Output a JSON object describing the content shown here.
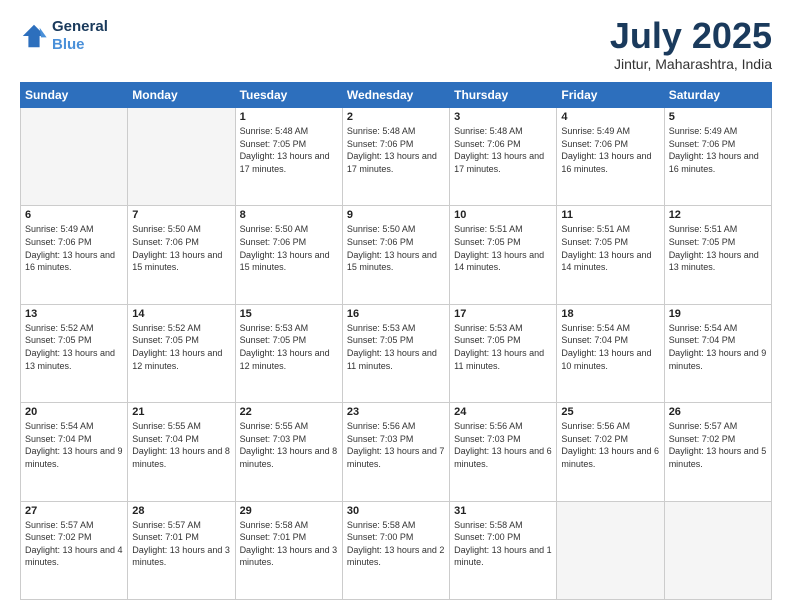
{
  "logo": {
    "line1": "General",
    "line2": "Blue"
  },
  "title": "July 2025",
  "location": "Jintur, Maharashtra, India",
  "days_of_week": [
    "Sunday",
    "Monday",
    "Tuesday",
    "Wednesday",
    "Thursday",
    "Friday",
    "Saturday"
  ],
  "weeks": [
    [
      {
        "day": "",
        "info": ""
      },
      {
        "day": "",
        "info": ""
      },
      {
        "day": "1",
        "info": "Sunrise: 5:48 AM\nSunset: 7:05 PM\nDaylight: 13 hours\nand 17 minutes."
      },
      {
        "day": "2",
        "info": "Sunrise: 5:48 AM\nSunset: 7:06 PM\nDaylight: 13 hours\nand 17 minutes."
      },
      {
        "day": "3",
        "info": "Sunrise: 5:48 AM\nSunset: 7:06 PM\nDaylight: 13 hours\nand 17 minutes."
      },
      {
        "day": "4",
        "info": "Sunrise: 5:49 AM\nSunset: 7:06 PM\nDaylight: 13 hours\nand 16 minutes."
      },
      {
        "day": "5",
        "info": "Sunrise: 5:49 AM\nSunset: 7:06 PM\nDaylight: 13 hours\nand 16 minutes."
      }
    ],
    [
      {
        "day": "6",
        "info": "Sunrise: 5:49 AM\nSunset: 7:06 PM\nDaylight: 13 hours\nand 16 minutes."
      },
      {
        "day": "7",
        "info": "Sunrise: 5:50 AM\nSunset: 7:06 PM\nDaylight: 13 hours\nand 15 minutes."
      },
      {
        "day": "8",
        "info": "Sunrise: 5:50 AM\nSunset: 7:06 PM\nDaylight: 13 hours\nand 15 minutes."
      },
      {
        "day": "9",
        "info": "Sunrise: 5:50 AM\nSunset: 7:06 PM\nDaylight: 13 hours\nand 15 minutes."
      },
      {
        "day": "10",
        "info": "Sunrise: 5:51 AM\nSunset: 7:05 PM\nDaylight: 13 hours\nand 14 minutes."
      },
      {
        "day": "11",
        "info": "Sunrise: 5:51 AM\nSunset: 7:05 PM\nDaylight: 13 hours\nand 14 minutes."
      },
      {
        "day": "12",
        "info": "Sunrise: 5:51 AM\nSunset: 7:05 PM\nDaylight: 13 hours\nand 13 minutes."
      }
    ],
    [
      {
        "day": "13",
        "info": "Sunrise: 5:52 AM\nSunset: 7:05 PM\nDaylight: 13 hours\nand 13 minutes."
      },
      {
        "day": "14",
        "info": "Sunrise: 5:52 AM\nSunset: 7:05 PM\nDaylight: 13 hours\nand 12 minutes."
      },
      {
        "day": "15",
        "info": "Sunrise: 5:53 AM\nSunset: 7:05 PM\nDaylight: 13 hours\nand 12 minutes."
      },
      {
        "day": "16",
        "info": "Sunrise: 5:53 AM\nSunset: 7:05 PM\nDaylight: 13 hours\nand 11 minutes."
      },
      {
        "day": "17",
        "info": "Sunrise: 5:53 AM\nSunset: 7:05 PM\nDaylight: 13 hours\nand 11 minutes."
      },
      {
        "day": "18",
        "info": "Sunrise: 5:54 AM\nSunset: 7:04 PM\nDaylight: 13 hours\nand 10 minutes."
      },
      {
        "day": "19",
        "info": "Sunrise: 5:54 AM\nSunset: 7:04 PM\nDaylight: 13 hours\nand 9 minutes."
      }
    ],
    [
      {
        "day": "20",
        "info": "Sunrise: 5:54 AM\nSunset: 7:04 PM\nDaylight: 13 hours\nand 9 minutes."
      },
      {
        "day": "21",
        "info": "Sunrise: 5:55 AM\nSunset: 7:04 PM\nDaylight: 13 hours\nand 8 minutes."
      },
      {
        "day": "22",
        "info": "Sunrise: 5:55 AM\nSunset: 7:03 PM\nDaylight: 13 hours\nand 8 minutes."
      },
      {
        "day": "23",
        "info": "Sunrise: 5:56 AM\nSunset: 7:03 PM\nDaylight: 13 hours\nand 7 minutes."
      },
      {
        "day": "24",
        "info": "Sunrise: 5:56 AM\nSunset: 7:03 PM\nDaylight: 13 hours\nand 6 minutes."
      },
      {
        "day": "25",
        "info": "Sunrise: 5:56 AM\nSunset: 7:02 PM\nDaylight: 13 hours\nand 6 minutes."
      },
      {
        "day": "26",
        "info": "Sunrise: 5:57 AM\nSunset: 7:02 PM\nDaylight: 13 hours\nand 5 minutes."
      }
    ],
    [
      {
        "day": "27",
        "info": "Sunrise: 5:57 AM\nSunset: 7:02 PM\nDaylight: 13 hours\nand 4 minutes."
      },
      {
        "day": "28",
        "info": "Sunrise: 5:57 AM\nSunset: 7:01 PM\nDaylight: 13 hours\nand 3 minutes."
      },
      {
        "day": "29",
        "info": "Sunrise: 5:58 AM\nSunset: 7:01 PM\nDaylight: 13 hours\nand 3 minutes."
      },
      {
        "day": "30",
        "info": "Sunrise: 5:58 AM\nSunset: 7:00 PM\nDaylight: 13 hours\nand 2 minutes."
      },
      {
        "day": "31",
        "info": "Sunrise: 5:58 AM\nSunset: 7:00 PM\nDaylight: 13 hours\nand 1 minute."
      },
      {
        "day": "",
        "info": ""
      },
      {
        "day": "",
        "info": ""
      }
    ]
  ]
}
